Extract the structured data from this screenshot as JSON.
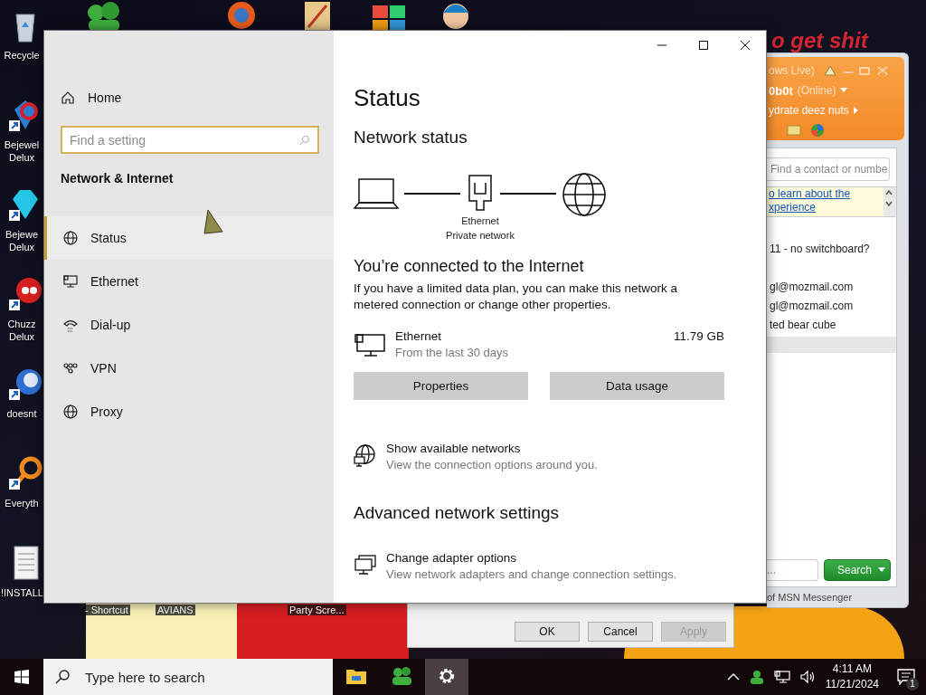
{
  "wallpaper": {
    "slogan": "o get shit",
    "labels": [
      "- Shortcut",
      "AVIANS",
      "Party Scre..."
    ]
  },
  "desktop_icons": [
    {
      "label": "Recycle",
      "kind": "recycle"
    },
    {
      "label": "Bejewel Delux",
      "kind": "gem2"
    },
    {
      "label": "Bejewe Delux",
      "kind": "gem"
    },
    {
      "label": "Chuzz Delux",
      "kind": "chuzzle"
    },
    {
      "label": "doesnt",
      "kind": "bird"
    },
    {
      "label": "Everyth",
      "kind": "ring"
    },
    {
      "label": "!INSTALL",
      "kind": "document"
    }
  ],
  "msn_window": {
    "title": "ows Live)",
    "user": "0b0t",
    "status": "(Online)",
    "personal_message": "ydrate deez nuts",
    "search_placeholder": "Find a contact or numbe",
    "notice_link": [
      "o learn about the",
      "xperience"
    ],
    "contacts": [
      {
        "text": "11 - no switchboard?",
        "selected": false
      },
      {
        "text": "gl@mozmail.com",
        "selected": false
      },
      {
        "text": "gl@mozmail.com",
        "selected": false
      },
      {
        "text": "ted bear cube",
        "selected": false
      }
    ],
    "web_search_value": "...",
    "search_button": "Search",
    "footer": "of MSN Messenger"
  },
  "properties_dialog": {
    "buttons": [
      {
        "label": "OK",
        "disabled": false
      },
      {
        "label": "Cancel",
        "disabled": false
      },
      {
        "label": "Apply",
        "disabled": true
      }
    ]
  },
  "settings_window": {
    "sidebar": {
      "home": "Home",
      "search_placeholder": "Find a setting",
      "section_title": "Network & Internet",
      "items": [
        {
          "label": "Status",
          "kind": "status",
          "selected": true
        },
        {
          "label": "Ethernet",
          "kind": "ethernet",
          "selected": false
        },
        {
          "label": "Dial-up",
          "kind": "dialup",
          "selected": false
        },
        {
          "label": "VPN",
          "kind": "vpn",
          "selected": false
        },
        {
          "label": "Proxy",
          "kind": "proxy",
          "selected": false
        }
      ]
    },
    "content": {
      "title": "Status",
      "network_status_heading": "Network status",
      "diagram": {
        "adapter": "Ethernet",
        "network": "Private network"
      },
      "connected_heading": "You’re connected to the Internet",
      "connected_text": "If you have a limited data plan, you can make this network a metered connection or change other properties.",
      "connection": {
        "name": "Ethernet",
        "detail": "From the last 30 days",
        "usage": "11.79 GB"
      },
      "buttons": [
        "Properties",
        "Data usage"
      ],
      "show_networks": {
        "title": "Show available networks",
        "subtitle": "View the connection options around you."
      },
      "advanced_heading": "Advanced network settings",
      "advanced_items": [
        {
          "title": "Change adapter options",
          "subtitle": "View network adapters and change connection settings."
        }
      ]
    }
  },
  "taskbar": {
    "search_placeholder": "Type here to search",
    "apps": [
      {
        "kind": "explorer",
        "selected": false
      },
      {
        "kind": "messenger",
        "selected": false
      },
      {
        "kind": "settings",
        "selected": true
      }
    ],
    "time": "4:11 AM",
    "date": "11/21/2024",
    "notification_count": "1"
  }
}
